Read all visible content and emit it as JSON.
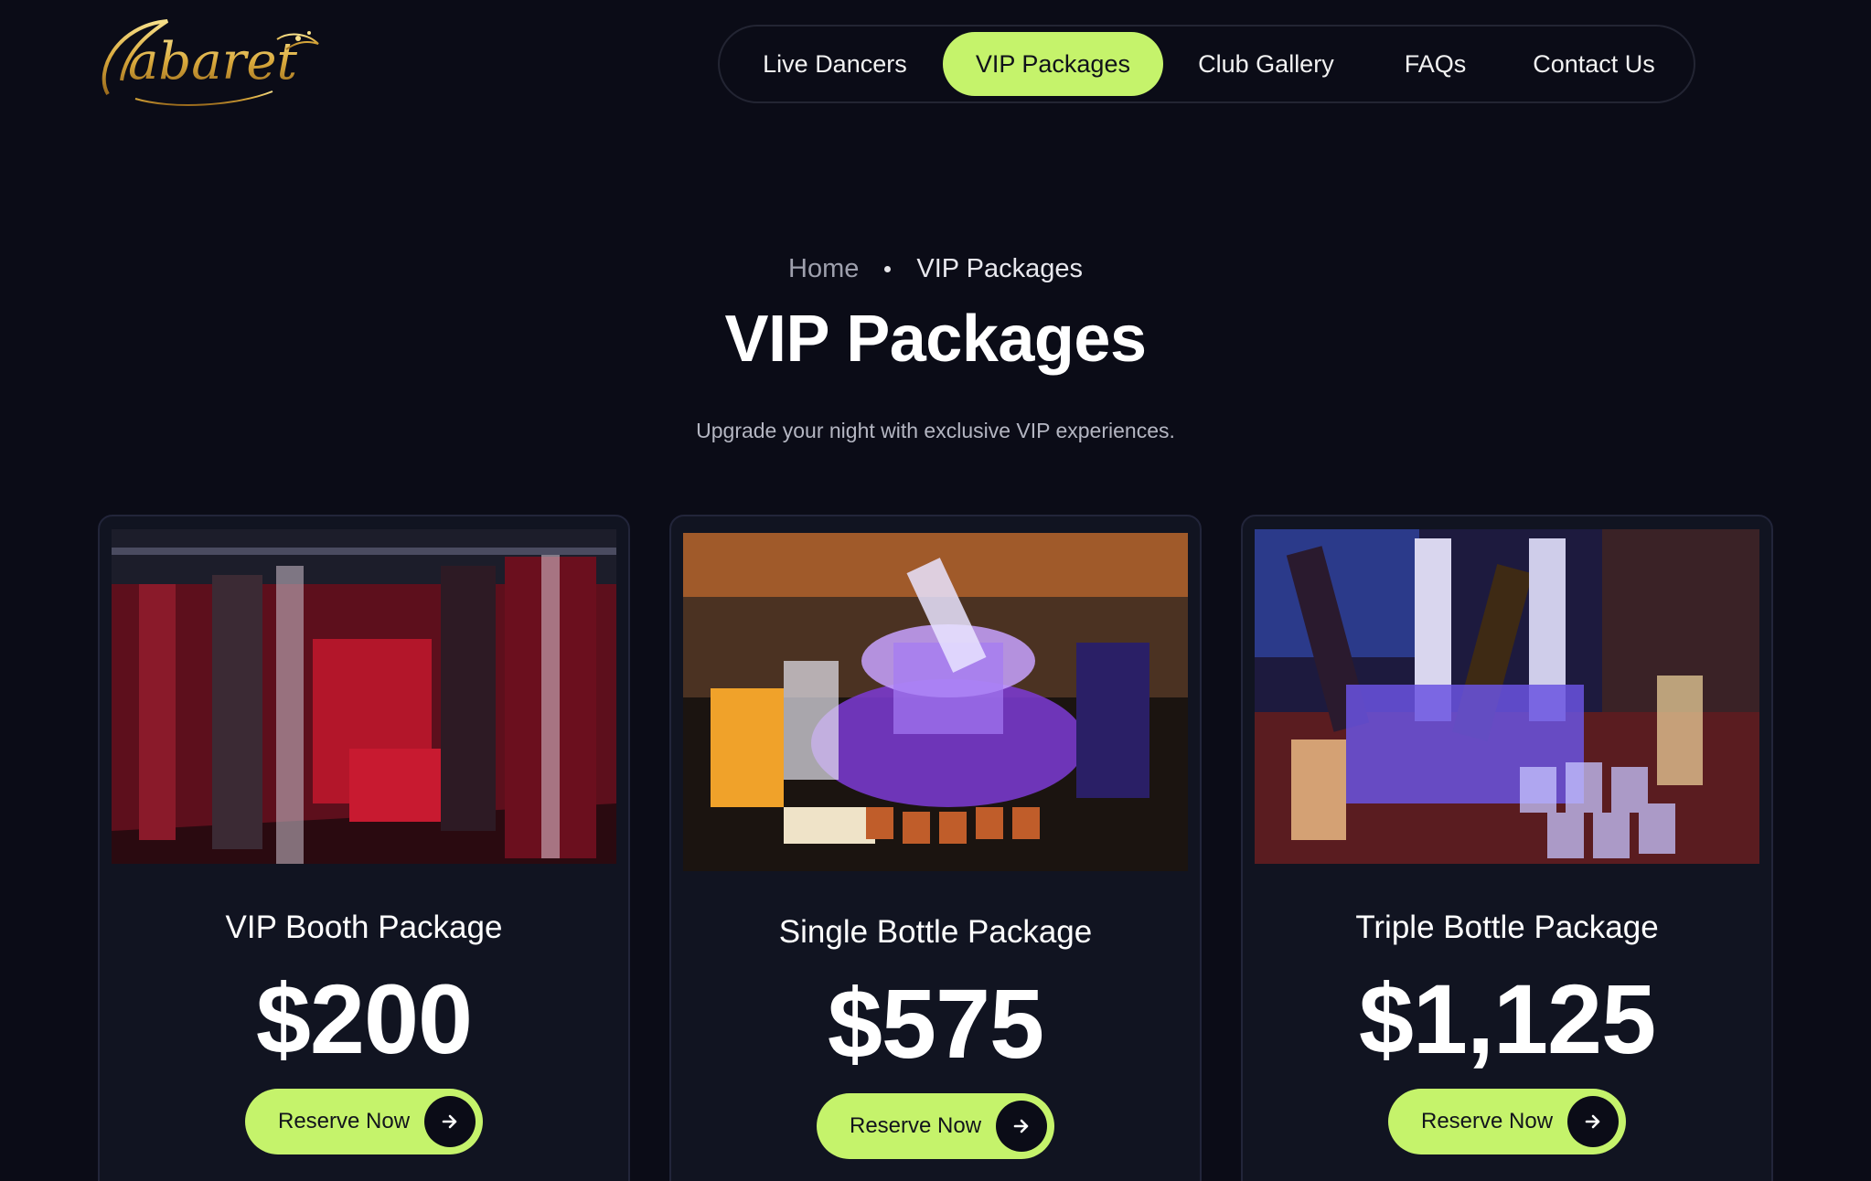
{
  "brand": {
    "logo_text": "Cabaret"
  },
  "nav": {
    "items": [
      {
        "label": "Live Dancers"
      },
      {
        "label": "VIP Packages"
      },
      {
        "label": "Club Gallery"
      },
      {
        "label": "FAQs"
      },
      {
        "label": "Contact Us"
      }
    ],
    "active_index": 1
  },
  "breadcrumb": {
    "home": "Home",
    "current": "VIP Packages"
  },
  "hero": {
    "title": "VIP Packages",
    "subtitle": "Upgrade your night with exclusive VIP experiences."
  },
  "packages": [
    {
      "title": "VIP Booth Package",
      "price": "$200",
      "cta": "Reserve Now",
      "image_icon": "vip-booth-photo"
    },
    {
      "title": "Single Bottle Package",
      "price": "$575",
      "cta": "Reserve Now",
      "image_icon": "single-bottle-photo"
    },
    {
      "title": "Triple Bottle Package",
      "price": "$1,125",
      "cta": "Reserve Now",
      "image_icon": "triple-bottle-photo"
    }
  ],
  "colors": {
    "background": "#0b0c17",
    "card": "#111421",
    "accent": "#c5f36b",
    "logo_gold": "#d9a93c"
  }
}
